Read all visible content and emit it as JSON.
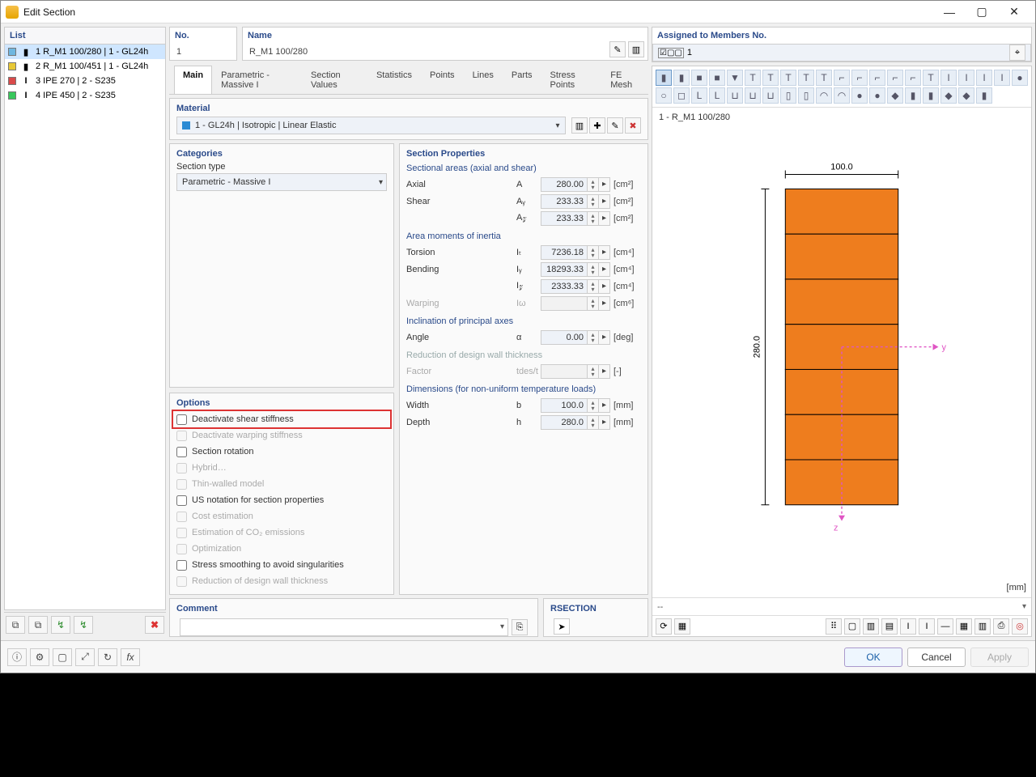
{
  "window": {
    "title": "Edit Section"
  },
  "left": {
    "header": "List",
    "items": [
      {
        "idx": "1",
        "label": "R_M1 100/280 | 1 - GL24h",
        "color": "#6fb7e0",
        "i": "▮"
      },
      {
        "idx": "2",
        "label": "R_M1 100/451 | 1 - GL24h",
        "color": "#e7c836",
        "i": "▮"
      },
      {
        "idx": "3",
        "label": "IPE 270 | 2 - S235",
        "color": "#d94a4a",
        "i": "I"
      },
      {
        "idx": "4",
        "label": "IPE 450 | 2 - S235",
        "color": "#38c75b",
        "i": "I"
      }
    ]
  },
  "header": {
    "no_label": "No.",
    "no_value": "1",
    "name_label": "Name",
    "name_value": "R_M1 100/280",
    "assigned_label": "Assigned to Members No.",
    "assigned_value": "1"
  },
  "tabs": [
    "Main",
    "Parametric - Massive I",
    "Section Values",
    "Statistics",
    "Points",
    "Lines",
    "Parts",
    "Stress Points",
    "FE Mesh"
  ],
  "material": {
    "title": "Material",
    "value": "1 - GL24h | Isotropic | Linear Elastic"
  },
  "categories": {
    "title": "Categories",
    "sectiontype_label": "Section type",
    "sectiontype_value": "Parametric - Massive I"
  },
  "options": {
    "title": "Options",
    "items": [
      {
        "label": "Deactivate shear stiffness",
        "enabled": true,
        "hl": true
      },
      {
        "label": "Deactivate warping stiffness",
        "enabled": false
      },
      {
        "label": "Section rotation",
        "enabled": true
      },
      {
        "label": "Hybrid…",
        "enabled": false
      },
      {
        "label": "Thin-walled model",
        "enabled": false
      },
      {
        "label": "US notation for section properties",
        "enabled": true
      },
      {
        "label": "Cost estimation",
        "enabled": false
      },
      {
        "label": "Estimation of CO₂ emissions",
        "enabled": false
      },
      {
        "label": "Optimization",
        "enabled": false
      },
      {
        "label": "Stress smoothing to avoid singularities",
        "enabled": true
      },
      {
        "label": "Reduction of design wall thickness",
        "enabled": false
      }
    ]
  },
  "props": {
    "title": "Section Properties",
    "groups": [
      {
        "h": "Sectional areas (axial and shear)",
        "rows": [
          {
            "n": "Axial",
            "s": "A",
            "v": "280.00",
            "u": "[cm²]"
          },
          {
            "n": "Shear",
            "s": "Aᵧ",
            "v": "233.33",
            "u": "[cm²]"
          },
          {
            "n": "",
            "s": "A𝓏",
            "v": "233.33",
            "u": "[cm²]"
          }
        ]
      },
      {
        "h": "Area moments of inertia",
        "rows": [
          {
            "n": "Torsion",
            "s": "Iₜ",
            "v": "7236.18",
            "u": "[cm⁴]"
          },
          {
            "n": "Bending",
            "s": "Iᵧ",
            "v": "18293.33",
            "u": "[cm⁴]"
          },
          {
            "n": "",
            "s": "I𝓏",
            "v": "2333.33",
            "u": "[cm⁴]"
          },
          {
            "n": "Warping",
            "s": "Iω",
            "v": "",
            "u": "[cm⁶]",
            "dis": true
          }
        ]
      },
      {
        "h": "Inclination of principal axes",
        "rows": [
          {
            "n": "Angle",
            "s": "α",
            "v": "0.00",
            "u": "[deg]"
          }
        ]
      },
      {
        "h": "Reduction of design wall thickness",
        "dis": true,
        "rows": [
          {
            "n": "Factor",
            "s": "tdes/t",
            "v": "",
            "u": "[-]",
            "dis": true
          }
        ]
      },
      {
        "h": "Dimensions (for non-uniform temperature loads)",
        "rows": [
          {
            "n": "Width",
            "s": "b",
            "v": "100.0",
            "u": "[mm]"
          },
          {
            "n": "Depth",
            "s": "h",
            "v": "280.0",
            "u": "[mm]"
          }
        ]
      }
    ]
  },
  "preview": {
    "title": "1 - R_M1 100/280",
    "dim_w": "100.0",
    "dim_h": "280.0",
    "axis_y": "y",
    "axis_z": "z",
    "unit": "[mm]",
    "status": "--"
  },
  "comment": {
    "title": "Comment"
  },
  "rsection": {
    "title": "RSECTION"
  },
  "buttons": {
    "ok": "OK",
    "cancel": "Cancel",
    "apply": "Apply"
  }
}
